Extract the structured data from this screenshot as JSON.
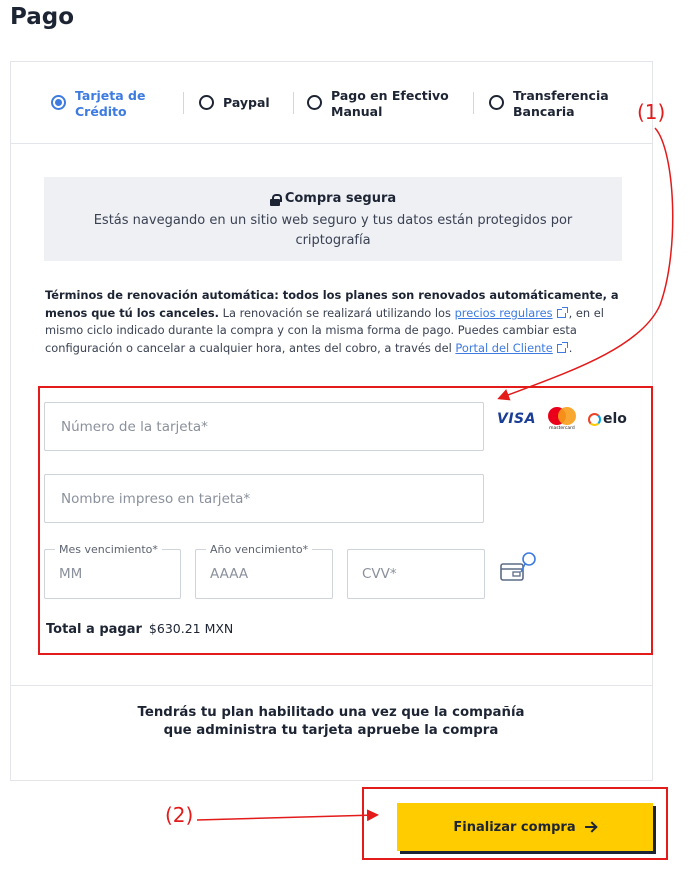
{
  "page": {
    "title": "Pago"
  },
  "payment_methods": [
    {
      "label_line1": "Tarjeta de",
      "label_line2": "Crédito",
      "selected": true
    },
    {
      "label_line1": "Paypal",
      "label_line2": "",
      "selected": false
    },
    {
      "label_line1": "Pago en Efectivo",
      "label_line2": "Manual",
      "selected": false
    },
    {
      "label_line1": "Transferencia",
      "label_line2": "Bancaria",
      "selected": false
    }
  ],
  "secure": {
    "title": "Compra segura",
    "text": "Estás navegando en un sitio web seguro y tus datos están protegidos por criptografía"
  },
  "terms": {
    "bold": "Términos de renovación automática: todos los planes son renovados automáticamente, a menos que tú los canceles.",
    "text1": " La renovación se realizará utilizando los ",
    "link1": "precios regulares",
    "text2": ", en el mismo ciclo indicado durante la compra y con la misma forma de pago. Puedes cambiar esta configuración o cancelar a cualquier hora, antes del cobro, a través del ",
    "link2": "Portal del Cliente",
    "text3": "."
  },
  "form": {
    "card_number_placeholder": "Número de la tarjeta*",
    "card_name_placeholder": "Nombre impreso en tarjeta*",
    "month_label": "Mes vencimiento*",
    "month_placeholder": "MM",
    "year_label": "Año vencimiento*",
    "year_placeholder": "AAAA",
    "cvv_placeholder": "CVV*"
  },
  "brands": {
    "visa": "VISA",
    "mastercard": "mastercard",
    "elo": "elo"
  },
  "total": {
    "label": "Total a pagar",
    "amount": "$630.21 MXN"
  },
  "approval_text": "Tendrás tu plan habilitado una vez que la compañía que administra tu tarjeta apruebe la compra",
  "finish_button": {
    "label": "Finalizar compra"
  },
  "annotations": {
    "one": "(1)",
    "two": "(2)",
    "color": "#e31b1b"
  },
  "colors": {
    "accent": "#3d7be0",
    "button": "#ffcc00",
    "text": "#1d2433"
  }
}
